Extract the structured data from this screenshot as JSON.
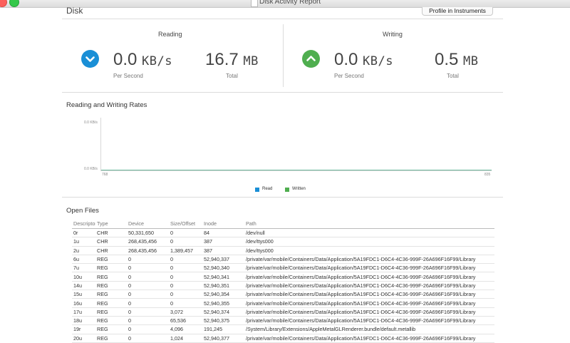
{
  "window": {
    "title": "Disk Activity Report"
  },
  "header": {
    "title": "Disk",
    "profile_button": "Profile in Instruments"
  },
  "reading": {
    "title": "Reading",
    "rate_value": "0.0",
    "rate_unit": "KB/s",
    "rate_label": "Per Second",
    "total_value": "16.7",
    "total_unit": "MB",
    "total_label": "Total",
    "icon": "chevron-down-circle-icon",
    "color": "#1a8fd6"
  },
  "writing": {
    "title": "Writing",
    "rate_value": "0.0",
    "rate_unit": "KB/s",
    "rate_label": "Per Second",
    "total_value": "0.5",
    "total_unit": "MB",
    "total_label": "Total",
    "icon": "chevron-up-circle-icon",
    "color": "#4fae4f"
  },
  "chart_data": {
    "type": "line",
    "title": "Reading and Writing Rates",
    "y_tick_labels": [
      "0.0 KB/s",
      "0.0 KB/s"
    ],
    "x_tick_labels": [
      "768",
      "835"
    ],
    "x": [
      768,
      835
    ],
    "ylim": [
      0.0,
      0.0
    ],
    "series": [
      {
        "name": "Read",
        "color": "#1a8fd6",
        "values": [
          0.0,
          0.0
        ]
      },
      {
        "name": "Written",
        "color": "#4fae4f",
        "values": [
          0.0,
          0.0
        ]
      }
    ],
    "legend_position": "bottom-center",
    "grid": false
  },
  "open_files": {
    "title": "Open Files",
    "columns": [
      "Descriptor",
      "Type",
      "Device",
      "Size/Offset",
      "Inode",
      "Path"
    ],
    "rows": [
      [
        "0r",
        "CHR",
        "50,331,650",
        "0",
        "84",
        "/dev/null"
      ],
      [
        "1u",
        "CHR",
        "268,435,456",
        "0",
        "387",
        "/dev/ttys000"
      ],
      [
        "2u",
        "CHR",
        "268,435,456",
        "1,389,457",
        "387",
        "/dev/ttys000"
      ],
      [
        "6u",
        "REG",
        "0",
        "0",
        "52,940,337",
        "/private/var/mobile/Containers/Data/Application/5A19FDC1-D6C4-4C36-999F-26A696F16F99/Library"
      ],
      [
        "7u",
        "REG",
        "0",
        "0",
        "52,940,340",
        "/private/var/mobile/Containers/Data/Application/5A19FDC1-D6C4-4C36-999F-26A696F16F99/Library"
      ],
      [
        "10u",
        "REG",
        "0",
        "0",
        "52,940,341",
        "/private/var/mobile/Containers/Data/Application/5A19FDC1-D6C4-4C36-999F-26A696F16F99/Library"
      ],
      [
        "14u",
        "REG",
        "0",
        "0",
        "52,940,351",
        "/private/var/mobile/Containers/Data/Application/5A19FDC1-D6C4-4C36-999F-26A696F16F99/Library"
      ],
      [
        "15u",
        "REG",
        "0",
        "0",
        "52,940,354",
        "/private/var/mobile/Containers/Data/Application/5A19FDC1-D6C4-4C36-999F-26A696F16F99/Library"
      ],
      [
        "16u",
        "REG",
        "0",
        "0",
        "52,940,355",
        "/private/var/mobile/Containers/Data/Application/5A19FDC1-D6C4-4C36-999F-26A696F16F99/Library"
      ],
      [
        "17u",
        "REG",
        "0",
        "3,072",
        "52,940,374",
        "/private/var/mobile/Containers/Data/Application/5A19FDC1-D6C4-4C36-999F-26A696F16F99/Library"
      ],
      [
        "18u",
        "REG",
        "0",
        "65,536",
        "52,940,375",
        "/private/var/mobile/Containers/Data/Application/5A19FDC1-D6C4-4C36-999F-26A696F16F99/Library"
      ],
      [
        "19r",
        "REG",
        "0",
        "4,096",
        "191,245",
        "/System/Library/Extensions/AppleMetalGLRenderer.bundle/default.metallib"
      ],
      [
        "20u",
        "REG",
        "0",
        "1,024",
        "52,940,377",
        "/private/var/mobile/Containers/Data/Application/5A19FDC1-D6C4-4C36-999F-26A696F16F99/Library"
      ]
    ]
  }
}
